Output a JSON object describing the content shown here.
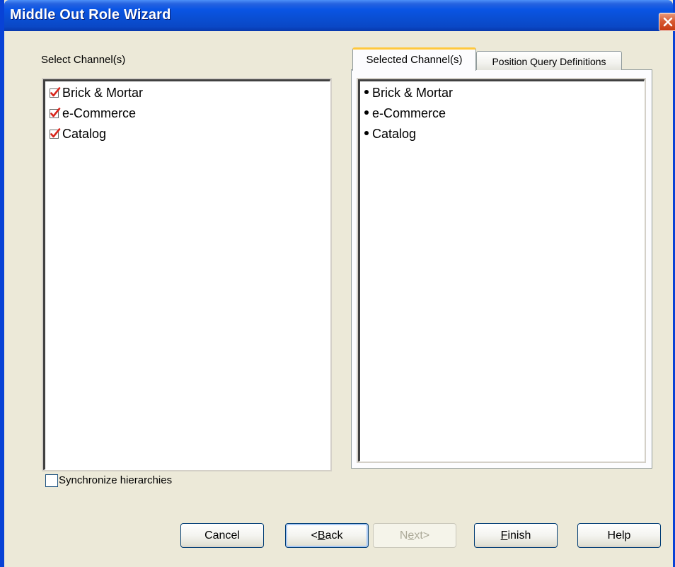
{
  "window": {
    "title": "Middle Out Role Wizard"
  },
  "left_panel": {
    "label": "Select Channel(s)",
    "items": [
      {
        "label": "Brick & Mortar",
        "checked": true
      },
      {
        "label": "e-Commerce",
        "checked": true
      },
      {
        "label": "Catalog",
        "checked": true
      }
    ]
  },
  "tabs": [
    {
      "label": "Selected Channel(s)",
      "active": true
    },
    {
      "label": "Position Query Definitions",
      "active": false
    }
  ],
  "right_panel": {
    "items": [
      {
        "label": "Brick & Mortar"
      },
      {
        "label": "e-Commerce"
      },
      {
        "label": "Catalog"
      }
    ]
  },
  "options": {
    "synchronize_label": "Synchronize hierarchies",
    "synchronize_checked": false
  },
  "buttons": {
    "cancel": "Cancel",
    "back_prefix": "<",
    "back_mnemonic": "B",
    "back_rest": "ack",
    "next_prefix": "N",
    "next_mnemonic": "e",
    "next_rest": "xt>",
    "finish_mnemonic": "F",
    "finish_rest": "inish",
    "help": "Help"
  },
  "colors": {
    "titlebar": "#0a4ed2",
    "close_button": "#d85a32",
    "check_mark": "#d8261c",
    "active_tab_accent": "#ffc83c",
    "dialog_background": "#ece9d8"
  }
}
